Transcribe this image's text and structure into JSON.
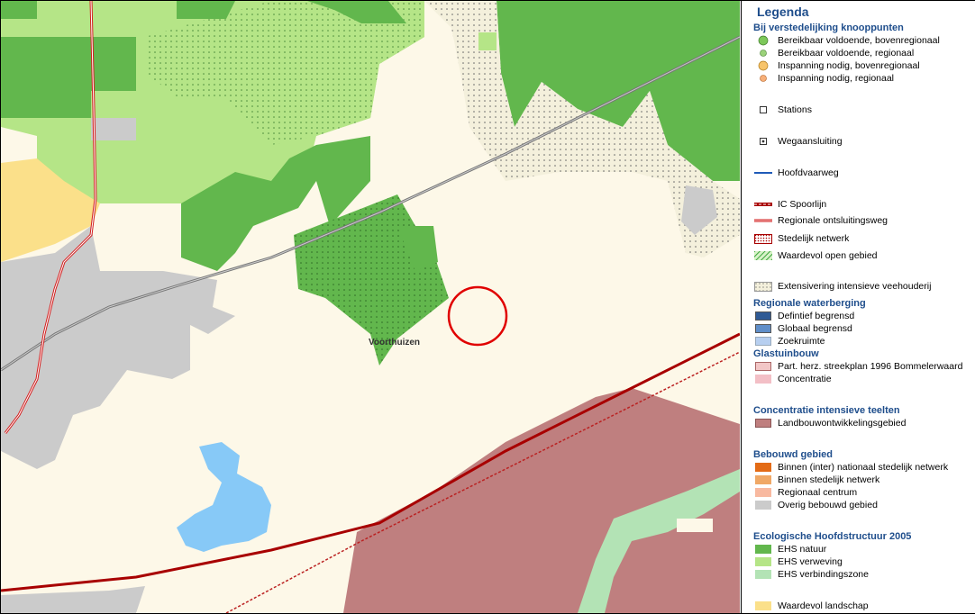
{
  "map": {
    "place_label": "Voorthuizen",
    "colors": {
      "background": "#fdf8e8",
      "ehs_natuur": "#62b74d",
      "ehs_verweving": "#b5e587",
      "ehs_verbindingszone": "#b3e3b5",
      "landbouw": "#bf7f7f",
      "bebouwd": "#cbcbcb",
      "water": "#87c9f7",
      "landschap": "#fbe08a",
      "highlight_circle": "#e00000"
    }
  },
  "legend": {
    "title": "Legenda",
    "sections": [
      {
        "heading": "Bij verstedelijking knooppunten",
        "items": [
          {
            "label": "Bereikbaar voldoende, bovenregionaal",
            "icon": "green-dot-large-icon"
          },
          {
            "label": "Bereikbaar voldoende, regionaal",
            "icon": "green-dot-small-icon"
          },
          {
            "label": "Inspanning nodig, bovenregionaal",
            "icon": "orange-dot-large-icon"
          },
          {
            "label": "Inspanning nodig, regionaal",
            "icon": "orange-dot-small-icon"
          },
          {
            "label": "Stations",
            "icon": "station-square-icon"
          },
          {
            "label": "Wegaansluiting",
            "icon": "road-junction-icon"
          },
          {
            "label": "Hoofdvaarweg",
            "icon": "waterway-line-icon"
          },
          {
            "label": "IC Spoorlijn",
            "icon": "ic-rail-line-icon"
          },
          {
            "label": "Regionale ontsluitingsweg",
            "icon": "regional-road-line-icon"
          },
          {
            "label": "Stedelijk netwerk",
            "icon": "urban-network-icon"
          },
          {
            "label": "Waardevol open gebied",
            "icon": "open-area-hatch-icon"
          },
          {
            "label": "Extensivering intensieve veehouderij",
            "icon": "dotted-area-icon"
          }
        ]
      },
      {
        "heading": "Regionale waterberging",
        "items": [
          {
            "label": "Defintief begrensd",
            "color": "#2f5a95"
          },
          {
            "label": "Globaal begrensd",
            "color": "#5f8ec9"
          },
          {
            "label": "Zoekruimte",
            "color": "#b7cff0"
          }
        ]
      },
      {
        "heading": "Glastuinbouw",
        "items": [
          {
            "label": "Part. herz. streekplan 1996 Bommelerwaard",
            "color": "#f2c6c6"
          },
          {
            "label": "Concentratie",
            "color": "#f3bfc6"
          }
        ]
      },
      {
        "heading": "Concentratie intensieve teelten",
        "items": [
          {
            "label": "Landbouwontwikkelingsgebied",
            "color": "#bf7f7f"
          }
        ]
      },
      {
        "heading": "Bebouwd gebied",
        "items": [
          {
            "label": "Binnen (inter) nationaal stedelijk netwerk",
            "color": "#e36b16"
          },
          {
            "label": "Binnen stedelijk netwerk",
            "color": "#f0a866"
          },
          {
            "label": "Regionaal centrum",
            "color": "#f8b9a0"
          },
          {
            "label": "Overig bebouwd gebied",
            "color": "#cbcbcb"
          }
        ]
      },
      {
        "heading": "Ecologische Hoofdstructuur 2005",
        "items": [
          {
            "label": "EHS natuur",
            "color": "#62b74d"
          },
          {
            "label": "EHS verweving",
            "color": "#b5e587"
          },
          {
            "label": "EHS verbindingszone",
            "color": "#b3e3b5"
          },
          {
            "label": "Waardevol landschap",
            "color": "#fbe08a"
          }
        ]
      }
    ]
  }
}
